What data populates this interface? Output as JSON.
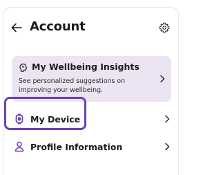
{
  "header": {
    "title": "Account",
    "back_icon": "arrow-left-icon",
    "settings_icon": "gear-icon"
  },
  "insights": {
    "title": "My Wellbeing Insights",
    "description": "See personalized suggestions on improving your wellbeing.",
    "icon": "brain-icon",
    "background": "#ece4f3"
  },
  "menu": {
    "device_label": "My Device",
    "device_icon": "watch-icon",
    "profile_label": "Profile Information",
    "profile_icon": "person-icon"
  },
  "colors": {
    "accent": "#6c3fb5",
    "text": "#1b1b1b"
  }
}
